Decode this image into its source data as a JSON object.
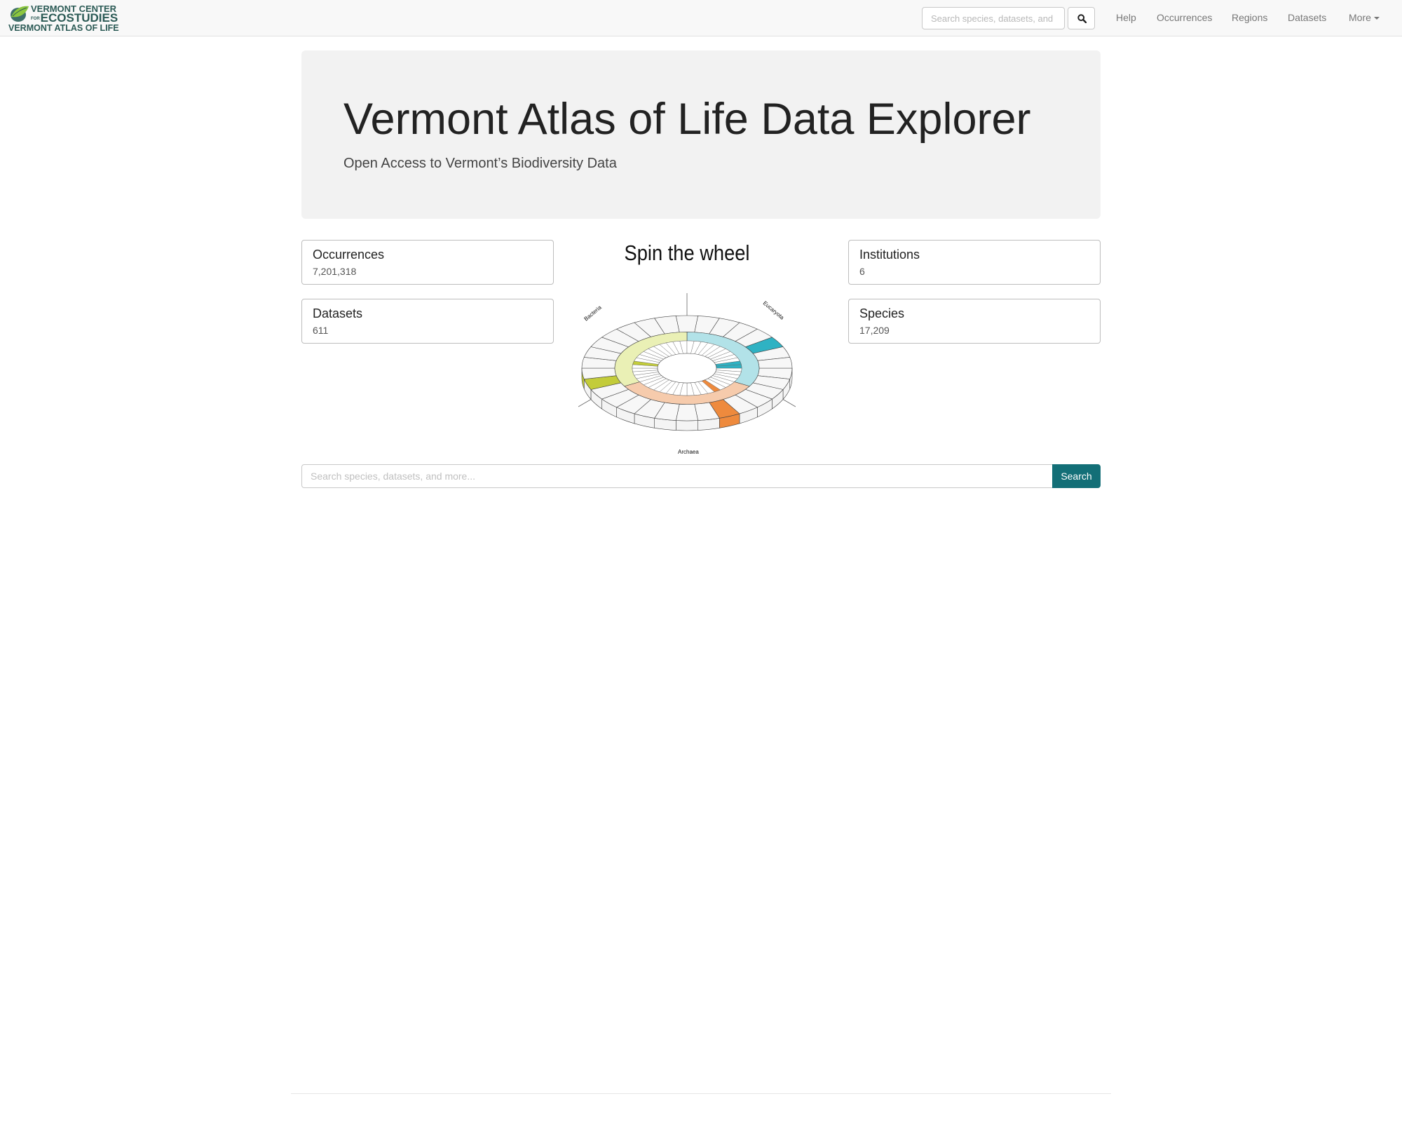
{
  "navbar": {
    "logo": {
      "line1": "VERMONT CENTER",
      "line2_small": "FOR",
      "line2": "ECOSTUDIES",
      "line3": "VERMONT ATLAS OF LIFE",
      "icon": "leaf-globe-icon"
    },
    "search": {
      "placeholder": "Search species, datasets, and more..."
    },
    "search_button_icon": "search-icon",
    "links": [
      "Help",
      "Occurrences",
      "Regions",
      "Datasets",
      "More"
    ]
  },
  "hero": {
    "title": "Vermont Atlas of Life Data Explorer",
    "subtitle": "Open Access to Vermont’s Biodiversity Data"
  },
  "stats": {
    "occurrences": {
      "label": "Occurrences",
      "value": "7,201,318"
    },
    "datasets": {
      "label": "Datasets",
      "value": "611"
    },
    "institutions": {
      "label": "Institutions",
      "value": "6"
    },
    "species": {
      "label": "Species",
      "value": "17,209"
    }
  },
  "wheel": {
    "title": "Spin the wheel",
    "labels": {
      "bacteria": "Bacteria",
      "eucaryota": "Eucaryota",
      "archaea": "Archaea"
    },
    "colors": {
      "bacteria": "#c3cc3a",
      "eucaryota": "#2fb2c3",
      "archaea": "#ee8a3d",
      "bacteria_light": "#eaf0b5",
      "eucaryota_light": "#b2e2e8",
      "archaea_light": "#f6cbac"
    }
  },
  "main_search": {
    "placeholder": "Search species, datasets, and more...",
    "button_label": "Search",
    "button_color": "#136f77"
  }
}
